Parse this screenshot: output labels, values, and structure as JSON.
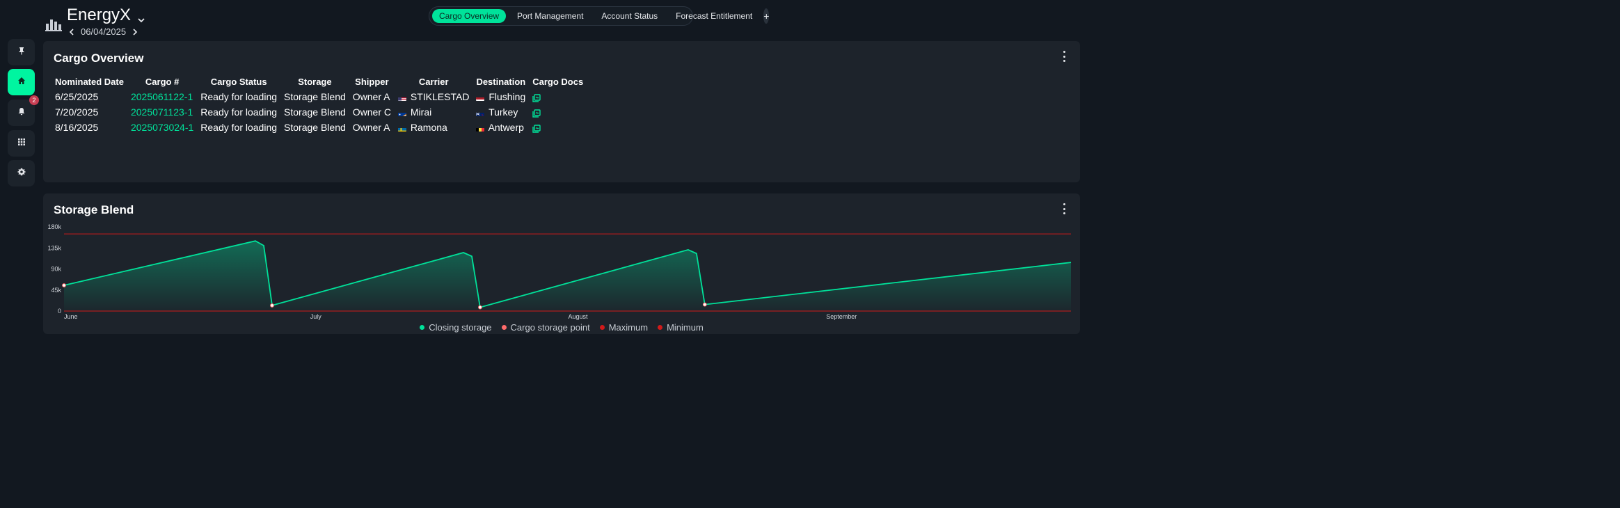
{
  "header": {
    "app_name": "EnergyX",
    "date": "06/04/2025",
    "tabs": [
      {
        "label": "Cargo Overview",
        "active": true
      },
      {
        "label": "Port Management",
        "active": false
      },
      {
        "label": "Account Status",
        "active": false
      },
      {
        "label": "Forecast Entitlement",
        "active": false
      }
    ],
    "add_tab_label": "+"
  },
  "sidebar": {
    "items": [
      {
        "icon": "pin-icon",
        "active": false
      },
      {
        "icon": "home-icon",
        "active": true
      },
      {
        "icon": "bell-icon",
        "active": false,
        "badge": "2"
      },
      {
        "icon": "apps-grid-icon",
        "active": false
      },
      {
        "icon": "gear-icon",
        "active": false
      }
    ]
  },
  "cargo_overview": {
    "title": "Cargo Overview",
    "columns": [
      "Nominated Date",
      "Cargo #",
      "Cargo Status",
      "Storage",
      "Shipper",
      "Carrier",
      "Destination",
      "Cargo Docs"
    ],
    "rows": [
      {
        "date": "6/25/2025",
        "cargo": "2025061122-1",
        "status": "Ready for loading",
        "storage": "Storage Blend",
        "shipper": "Owner A",
        "carrier": "STIKLESTAD",
        "carrier_flag": "us",
        "destination": "Flushing",
        "destination_flag": "nl"
      },
      {
        "date": "7/20/2025",
        "cargo": "2025071123-1",
        "status": "Ready for loading",
        "storage": "Storage Blend",
        "shipper": "Owner C",
        "carrier": "Mirai",
        "carrier_flag": "mh",
        "destination": "Turkey",
        "destination_flag": "nz"
      },
      {
        "date": "8/16/2025",
        "cargo": "2025073024-1",
        "status": "Ready for loading",
        "storage": "Storage Blend",
        "shipper": "Owner A",
        "carrier": "Ramona",
        "carrier_flag": "se",
        "destination": "Antwerp",
        "destination_flag": "be"
      }
    ]
  },
  "storage_blend": {
    "title": "Storage Blend",
    "colors": {
      "closing": "#00e29a",
      "cargo_point": "#ff6b6b",
      "limit": "#d11a1a"
    },
    "chart_data": {
      "type": "area",
      "y_ticks": [
        "180k",
        "135k",
        "90k",
        "45k",
        "0"
      ],
      "ylim": [
        0,
        180000
      ],
      "x_ticks": [
        "June",
        "July",
        "August",
        "September"
      ],
      "xlim": [
        "2025-06-01",
        "2025-09-30"
      ],
      "maximum": 165000,
      "minimum": 0,
      "series": [
        {
          "name": "Closing storage",
          "points": [
            {
              "x": "2025-06-01",
              "y": 55000
            },
            {
              "x": "2025-06-24",
              "y": 150000
            },
            {
              "x": "2025-06-25",
              "y": 140000
            },
            {
              "x": "2025-06-26",
              "y": 12000
            },
            {
              "x": "2025-07-19",
              "y": 125000
            },
            {
              "x": "2025-07-20",
              "y": 117000
            },
            {
              "x": "2025-07-21",
              "y": 8000
            },
            {
              "x": "2025-08-15",
              "y": 131000
            },
            {
              "x": "2025-08-16",
              "y": 123000
            },
            {
              "x": "2025-08-17",
              "y": 14000
            },
            {
              "x": "2025-09-30",
              "y": 104000
            }
          ]
        },
        {
          "name": "Cargo storage point",
          "points": [
            {
              "x": "2025-06-01",
              "y": 55000
            },
            {
              "x": "2025-06-26",
              "y": 12000
            },
            {
              "x": "2025-07-21",
              "y": 8000
            },
            {
              "x": "2025-08-17",
              "y": 14000
            }
          ]
        }
      ],
      "legend": [
        "Closing storage",
        "Cargo storage point",
        "Maximum",
        "Minimum"
      ],
      "legend_position": "bottom"
    }
  }
}
